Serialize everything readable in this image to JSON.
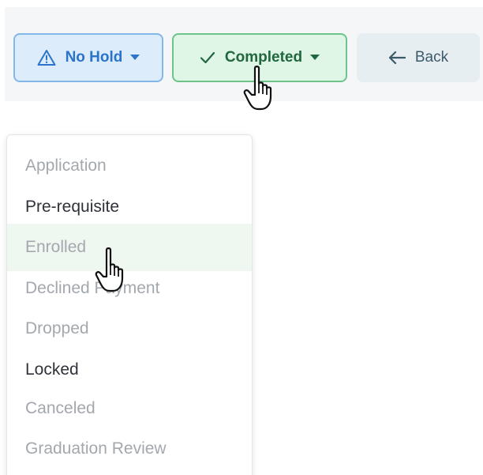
{
  "toolbar": {
    "hold_button": {
      "label": "No Hold",
      "icon": "warning-icon"
    },
    "status_button": {
      "label": "Completed",
      "icon": "checkmark-icon"
    },
    "back_button": {
      "label": "Back",
      "icon": "arrow-left-icon"
    }
  },
  "dropdown": {
    "options": [
      {
        "label": "Application",
        "state": "disabled"
      },
      {
        "label": "Pre-requisite",
        "state": "enabled"
      },
      {
        "label": "Enrolled",
        "state": "hovered"
      },
      {
        "label": "Declined Payment",
        "state": "disabled"
      },
      {
        "label": "Dropped",
        "state": "disabled"
      },
      {
        "label": "Locked",
        "state": "enabled"
      },
      {
        "label": "Canceled",
        "state": "disabled"
      },
      {
        "label": "Graduation Review",
        "state": "disabled"
      }
    ]
  },
  "colors": {
    "hold_accent": "#2b74c9",
    "status_accent": "#20663f",
    "back_accent": "#3d5a6b",
    "hover_row": "#eef8f1"
  }
}
